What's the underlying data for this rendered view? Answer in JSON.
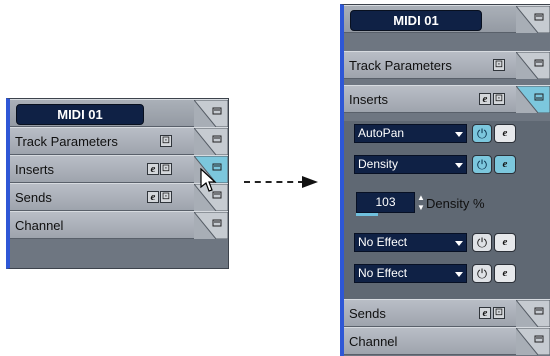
{
  "before": {
    "track_name": "MIDI 01",
    "sections": [
      {
        "label": "Track Parameters"
      },
      {
        "label": "Inserts"
      },
      {
        "label": "Sends"
      },
      {
        "label": "Channel"
      }
    ]
  },
  "after": {
    "track_name": "MIDI 01",
    "sections": [
      {
        "label": "Track Parameters"
      },
      {
        "label": "Inserts"
      },
      {
        "label": "Sends"
      },
      {
        "label": "Channel"
      }
    ],
    "insert_slots": [
      {
        "effect": "AutoPan",
        "power": "on",
        "edit": "off"
      },
      {
        "effect": "Density",
        "power": "on",
        "edit": "on"
      },
      {
        "effect": "No Effect",
        "power": "off",
        "edit": "off"
      },
      {
        "effect": "No Effect",
        "power": "off",
        "edit": "off"
      }
    ],
    "parameter": {
      "value": "103",
      "label": "Density %"
    }
  },
  "icons": {
    "edit_glyph": "e",
    "bypass_glyph": "⊡",
    "power_glyph": "⏻"
  },
  "colors": {
    "accent_blue": "#2e57d6",
    "field_navy": "#0f2145",
    "active_cyan": "#7cc7dd"
  }
}
